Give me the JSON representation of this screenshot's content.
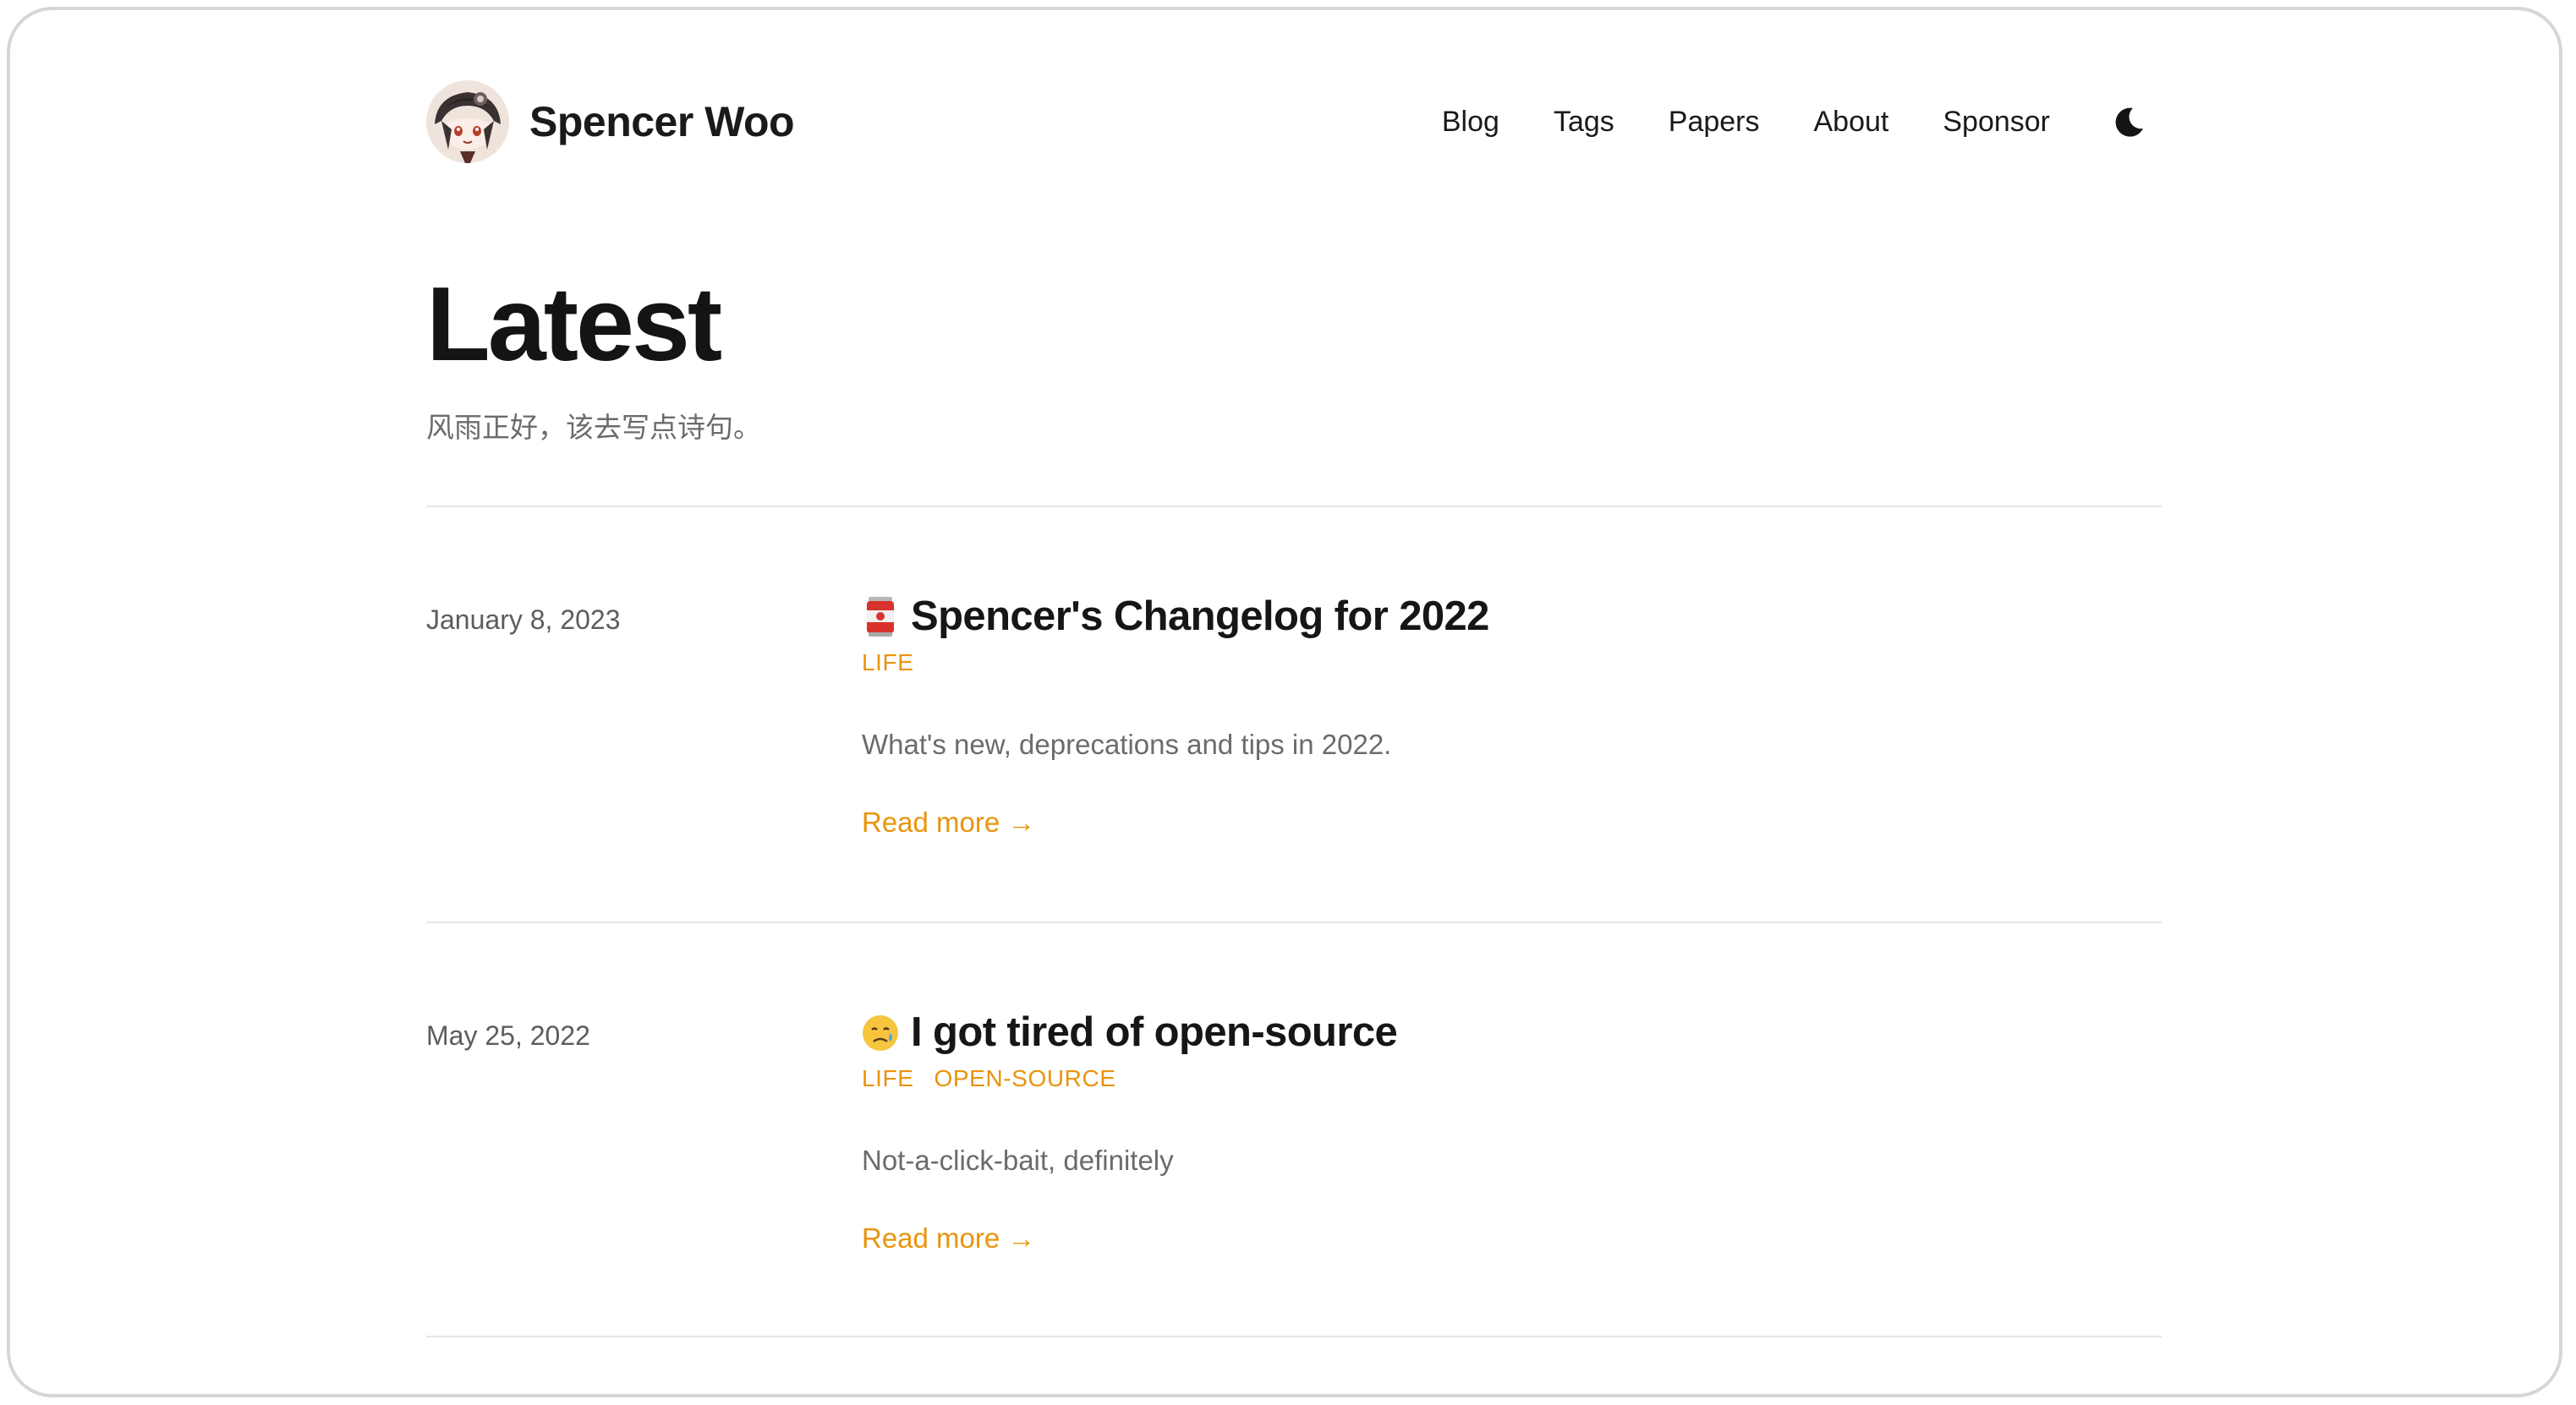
{
  "site": {
    "name": "Spencer Woo"
  },
  "nav": {
    "items": [
      {
        "label": "Blog"
      },
      {
        "label": "Tags"
      },
      {
        "label": "Papers"
      },
      {
        "label": "About"
      },
      {
        "label": "Sponsor"
      }
    ],
    "theme_toggle_icon": "moon-icon"
  },
  "page": {
    "title": "Latest",
    "subtitle": "风雨正好，该去写点诗句。"
  },
  "posts": [
    {
      "date": "January 8, 2023",
      "emoji_icon": "soda-can-icon",
      "title": "Spencer's Changelog for 2022",
      "tags": [
        "LIFE"
      ],
      "summary": "What's new, deprecations and tips in 2022.",
      "read_more": "Read more →"
    },
    {
      "date": "May 25, 2022",
      "emoji_icon": "crying-face-icon",
      "title": "I got tired of open-source",
      "tags": [
        "LIFE",
        "OPEN-SOURCE"
      ],
      "summary": "Not-a-click-bait, definitely",
      "read_more": "Read more →"
    }
  ],
  "colors": {
    "accent": "#e8940c",
    "text": "#1a1a1a",
    "muted": "#6b6b6b",
    "divider": "#e6e6e6"
  }
}
